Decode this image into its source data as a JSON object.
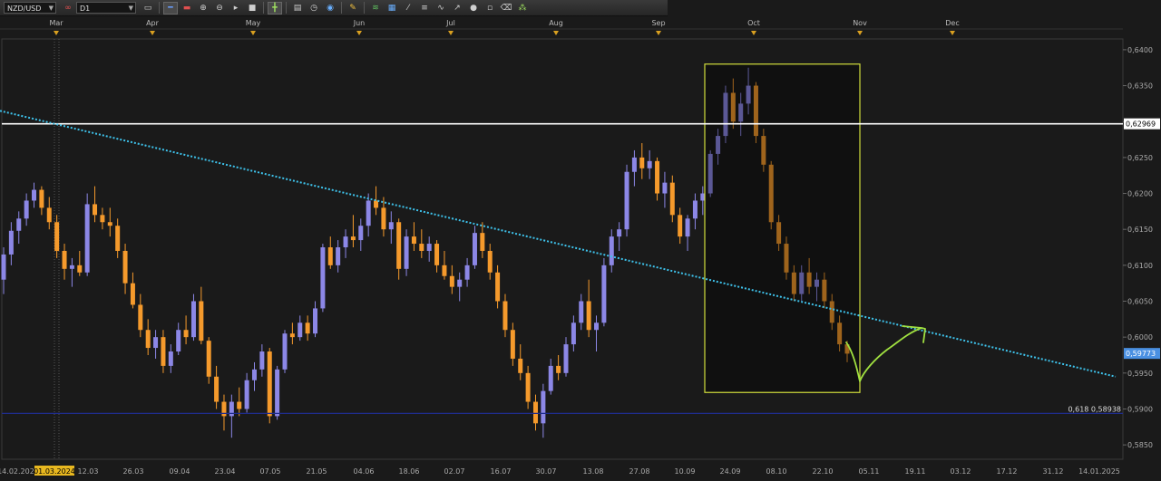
{
  "toolbar": {
    "symbol": "NZD/USD",
    "timeframe": "D1",
    "icons": [
      "chart-type-icon",
      "bar-style-icon",
      "candle-style-icon",
      "zoom-in-icon",
      "zoom-out-icon",
      "autoscroll-icon",
      "crosshair-icon",
      "text-tool-icon",
      "template-icon",
      "clock-icon",
      "globe-icon",
      "pencil-icon",
      "trend-tool-icon",
      "grid-icon",
      "fib-icon",
      "channel-icon",
      "wave-icon",
      "arrow-icon",
      "shape-icon",
      "eraser-icon",
      "objects-icon"
    ]
  },
  "colors": {
    "background": "#1a1a1a",
    "bull": "#8c87e6",
    "bear": "#f59a2c",
    "highlight_box": "#d2de3c",
    "trendline": "#3ec3ec",
    "resistance": "#ffffff",
    "fib_line": "#1f2c8c",
    "drawn_arrow": "#a0e040",
    "price_label": "#4a90e2"
  },
  "chart_data": {
    "type": "candlestick",
    "instrument": "NZD/USD",
    "timeframe": "D1",
    "y_range": [
      0.583,
      0.6415
    ],
    "y_ticks": [
      "0,6400",
      "0,6350",
      "0,6300",
      "0,6250",
      "0,6200",
      "0,6150",
      "0,6100",
      "0,6050",
      "0,6000",
      "0,5950",
      "0,5900",
      "0,5850"
    ],
    "month_labels": [
      "Mar",
      "Apr",
      "May",
      "Jun",
      "Jul",
      "Aug",
      "Sep",
      "Oct",
      "Nov",
      "Dec"
    ],
    "date_labels": [
      "14.02.2024",
      "01.03.2024",
      "12.03",
      "26.03",
      "09.04",
      "23.04",
      "07.05",
      "21.05",
      "04.06",
      "18.06",
      "02.07",
      "16.07",
      "30.07",
      "13.08",
      "27.08",
      "10.09",
      "24.09",
      "08.10",
      "22.10",
      "05.11",
      "19.11",
      "03.12",
      "17.12",
      "31.12",
      "14.01.2025"
    ],
    "resistance_level": {
      "price": 0.62969,
      "label": "0,62969"
    },
    "current_price": {
      "price": 0.59773,
      "label": "0,59773"
    },
    "fib_level": {
      "label": "0,618 0,58938",
      "price": 0.58938
    },
    "trendline": {
      "from": {
        "date": "14.02.2024",
        "price": 0.6315
      },
      "to": {
        "date": "14.01.2025",
        "price": 0.5945
      }
    },
    "highlight_period": {
      "from": "16.09",
      "to": "06.11",
      "high": 0.638,
      "low": 0.5923
    },
    "candles_ohlc": [
      [
        0.608,
        0.6125,
        0.606,
        0.6115
      ],
      [
        0.6115,
        0.616,
        0.61,
        0.6148
      ],
      [
        0.6148,
        0.6175,
        0.613,
        0.6165
      ],
      [
        0.6165,
        0.62,
        0.6155,
        0.619
      ],
      [
        0.619,
        0.6215,
        0.618,
        0.6205
      ],
      [
        0.6205,
        0.621,
        0.617,
        0.618
      ],
      [
        0.618,
        0.6195,
        0.615,
        0.616
      ],
      [
        0.616,
        0.617,
        0.611,
        0.612
      ],
      [
        0.612,
        0.613,
        0.608,
        0.6095
      ],
      [
        0.6095,
        0.611,
        0.607,
        0.61
      ],
      [
        0.61,
        0.612,
        0.6085,
        0.609
      ],
      [
        0.609,
        0.62,
        0.6085,
        0.6185
      ],
      [
        0.6185,
        0.621,
        0.616,
        0.617
      ],
      [
        0.617,
        0.618,
        0.615,
        0.616
      ],
      [
        0.616,
        0.618,
        0.614,
        0.6155
      ],
      [
        0.6155,
        0.6165,
        0.611,
        0.612
      ],
      [
        0.612,
        0.613,
        0.606,
        0.6075
      ],
      [
        0.6075,
        0.609,
        0.604,
        0.6045
      ],
      [
        0.6045,
        0.606,
        0.6,
        0.601
      ],
      [
        0.601,
        0.6025,
        0.5975,
        0.5985
      ],
      [
        0.5985,
        0.601,
        0.597,
        0.6
      ],
      [
        0.6,
        0.601,
        0.595,
        0.596
      ],
      [
        0.596,
        0.599,
        0.595,
        0.598
      ],
      [
        0.598,
        0.602,
        0.5975,
        0.601
      ],
      [
        0.601,
        0.603,
        0.599,
        0.6
      ],
      [
        0.6,
        0.606,
        0.5995,
        0.605
      ],
      [
        0.605,
        0.607,
        0.599,
        0.5995
      ],
      [
        0.5995,
        0.6,
        0.5935,
        0.5945
      ],
      [
        0.5945,
        0.596,
        0.59,
        0.591
      ],
      [
        0.591,
        0.592,
        0.587,
        0.589
      ],
      [
        0.589,
        0.592,
        0.586,
        0.591
      ],
      [
        0.591,
        0.593,
        0.589,
        0.59
      ],
      [
        0.59,
        0.595,
        0.5895,
        0.594
      ],
      [
        0.594,
        0.5965,
        0.5925,
        0.5955
      ],
      [
        0.5955,
        0.599,
        0.5945,
        0.598
      ],
      [
        0.598,
        0.5985,
        0.588,
        0.589
      ],
      [
        0.589,
        0.596,
        0.5885,
        0.5955
      ],
      [
        0.5955,
        0.601,
        0.595,
        0.6005
      ],
      [
        0.6005,
        0.602,
        0.599,
        0.6
      ],
      [
        0.6,
        0.603,
        0.5995,
        0.602
      ],
      [
        0.602,
        0.603,
        0.5995,
        0.6005
      ],
      [
        0.6005,
        0.605,
        0.6,
        0.604
      ],
      [
        0.604,
        0.613,
        0.6035,
        0.6125
      ],
      [
        0.6125,
        0.614,
        0.6095,
        0.61
      ],
      [
        0.61,
        0.6135,
        0.609,
        0.6125
      ],
      [
        0.6125,
        0.615,
        0.611,
        0.614
      ],
      [
        0.614,
        0.617,
        0.6125,
        0.6135
      ],
      [
        0.6135,
        0.6165,
        0.612,
        0.6155
      ],
      [
        0.6155,
        0.62,
        0.614,
        0.619
      ],
      [
        0.619,
        0.621,
        0.617,
        0.618
      ],
      [
        0.618,
        0.6195,
        0.614,
        0.615
      ],
      [
        0.615,
        0.6175,
        0.613,
        0.616
      ],
      [
        0.616,
        0.6165,
        0.608,
        0.6095
      ],
      [
        0.6095,
        0.615,
        0.6085,
        0.614
      ],
      [
        0.614,
        0.616,
        0.612,
        0.613
      ],
      [
        0.613,
        0.615,
        0.611,
        0.612
      ],
      [
        0.612,
        0.614,
        0.6105,
        0.613
      ],
      [
        0.613,
        0.6135,
        0.609,
        0.61
      ],
      [
        0.61,
        0.612,
        0.608,
        0.6085
      ],
      [
        0.6085,
        0.61,
        0.606,
        0.607
      ],
      [
        0.607,
        0.609,
        0.605,
        0.608
      ],
      [
        0.608,
        0.611,
        0.607,
        0.61
      ],
      [
        0.61,
        0.6155,
        0.6095,
        0.6145
      ],
      [
        0.6145,
        0.616,
        0.611,
        0.612
      ],
      [
        0.612,
        0.613,
        0.608,
        0.609
      ],
      [
        0.609,
        0.61,
        0.604,
        0.605
      ],
      [
        0.605,
        0.606,
        0.6,
        0.601
      ],
      [
        0.601,
        0.602,
        0.596,
        0.597
      ],
      [
        0.597,
        0.599,
        0.594,
        0.595
      ],
      [
        0.595,
        0.596,
        0.59,
        0.591
      ],
      [
        0.591,
        0.592,
        0.587,
        0.588
      ],
      [
        0.588,
        0.5935,
        0.586,
        0.5925
      ],
      [
        0.5925,
        0.597,
        0.592,
        0.596
      ],
      [
        0.596,
        0.5975,
        0.594,
        0.595
      ],
      [
        0.595,
        0.6,
        0.5945,
        0.599
      ],
      [
        0.599,
        0.603,
        0.598,
        0.602
      ],
      [
        0.602,
        0.606,
        0.601,
        0.605
      ],
      [
        0.605,
        0.608,
        0.6,
        0.601
      ],
      [
        0.601,
        0.603,
        0.598,
        0.602
      ],
      [
        0.602,
        0.611,
        0.6015,
        0.61
      ],
      [
        0.61,
        0.615,
        0.609,
        0.614
      ],
      [
        0.614,
        0.616,
        0.612,
        0.615
      ],
      [
        0.615,
        0.624,
        0.614,
        0.623
      ],
      [
        0.623,
        0.626,
        0.621,
        0.625
      ],
      [
        0.625,
        0.627,
        0.622,
        0.6235
      ],
      [
        0.6235,
        0.626,
        0.622,
        0.6245
      ],
      [
        0.6245,
        0.625,
        0.619,
        0.62
      ],
      [
        0.62,
        0.623,
        0.618,
        0.6215
      ],
      [
        0.6215,
        0.6225,
        0.616,
        0.617
      ],
      [
        0.617,
        0.618,
        0.613,
        0.614
      ],
      [
        0.614,
        0.617,
        0.612,
        0.6165
      ],
      [
        0.6165,
        0.62,
        0.615,
        0.619
      ],
      [
        0.619,
        0.621,
        0.617,
        0.62
      ],
      [
        0.62,
        0.626,
        0.6195,
        0.6255
      ],
      [
        0.6255,
        0.629,
        0.624,
        0.628
      ],
      [
        0.628,
        0.635,
        0.627,
        0.634
      ],
      [
        0.634,
        0.636,
        0.629,
        0.63
      ],
      [
        0.63,
        0.634,
        0.628,
        0.6325
      ],
      [
        0.6325,
        0.6375,
        0.631,
        0.635
      ],
      [
        0.635,
        0.6355,
        0.627,
        0.628
      ],
      [
        0.628,
        0.629,
        0.623,
        0.624
      ],
      [
        0.624,
        0.6245,
        0.615,
        0.616
      ],
      [
        0.616,
        0.617,
        0.612,
        0.613
      ],
      [
        0.613,
        0.614,
        0.608,
        0.609
      ],
      [
        0.609,
        0.61,
        0.605,
        0.606
      ],
      [
        0.606,
        0.61,
        0.605,
        0.609
      ],
      [
        0.609,
        0.611,
        0.606,
        0.607
      ],
      [
        0.607,
        0.609,
        0.605,
        0.608
      ],
      [
        0.608,
        0.609,
        0.604,
        0.605
      ],
      [
        0.605,
        0.606,
        0.601,
        0.602
      ],
      [
        0.602,
        0.603,
        0.598,
        0.599
      ],
      [
        0.599,
        0.5995,
        0.5965,
        0.5977
      ]
    ]
  }
}
